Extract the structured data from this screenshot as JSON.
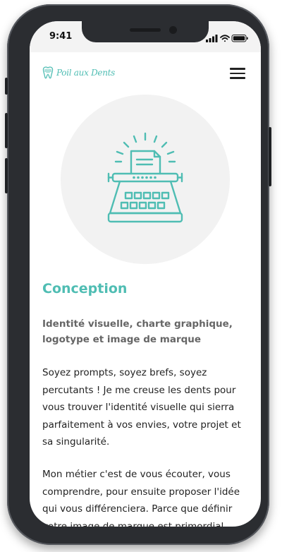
{
  "status_bar": {
    "time": "9:41"
  },
  "header": {
    "logo_text": "Poil aux Dents"
  },
  "hero": {
    "icon": "typewriter-icon"
  },
  "section": {
    "title": "Conception",
    "subtitle": "Identité visuelle, charte graphique, logotype et image de marque",
    "paragraphs": [
      "Soyez prompts, soyez brefs, soyez percutants ! Je me creuse les dents pour vous trouver l'identité visuelle qui sierra parfaitement à vos envies, votre projet et sa singularité.",
      "Mon métier c'est de vous écouter, vous comprendre, pour ensuite proposer l'idée qui vous différenciera. Parce que définir votre image de marque est primordial."
    ]
  },
  "colors": {
    "accent": "#4fbdb3",
    "frame": "#2b2d31",
    "hero_bg": "#f2f2f2"
  }
}
